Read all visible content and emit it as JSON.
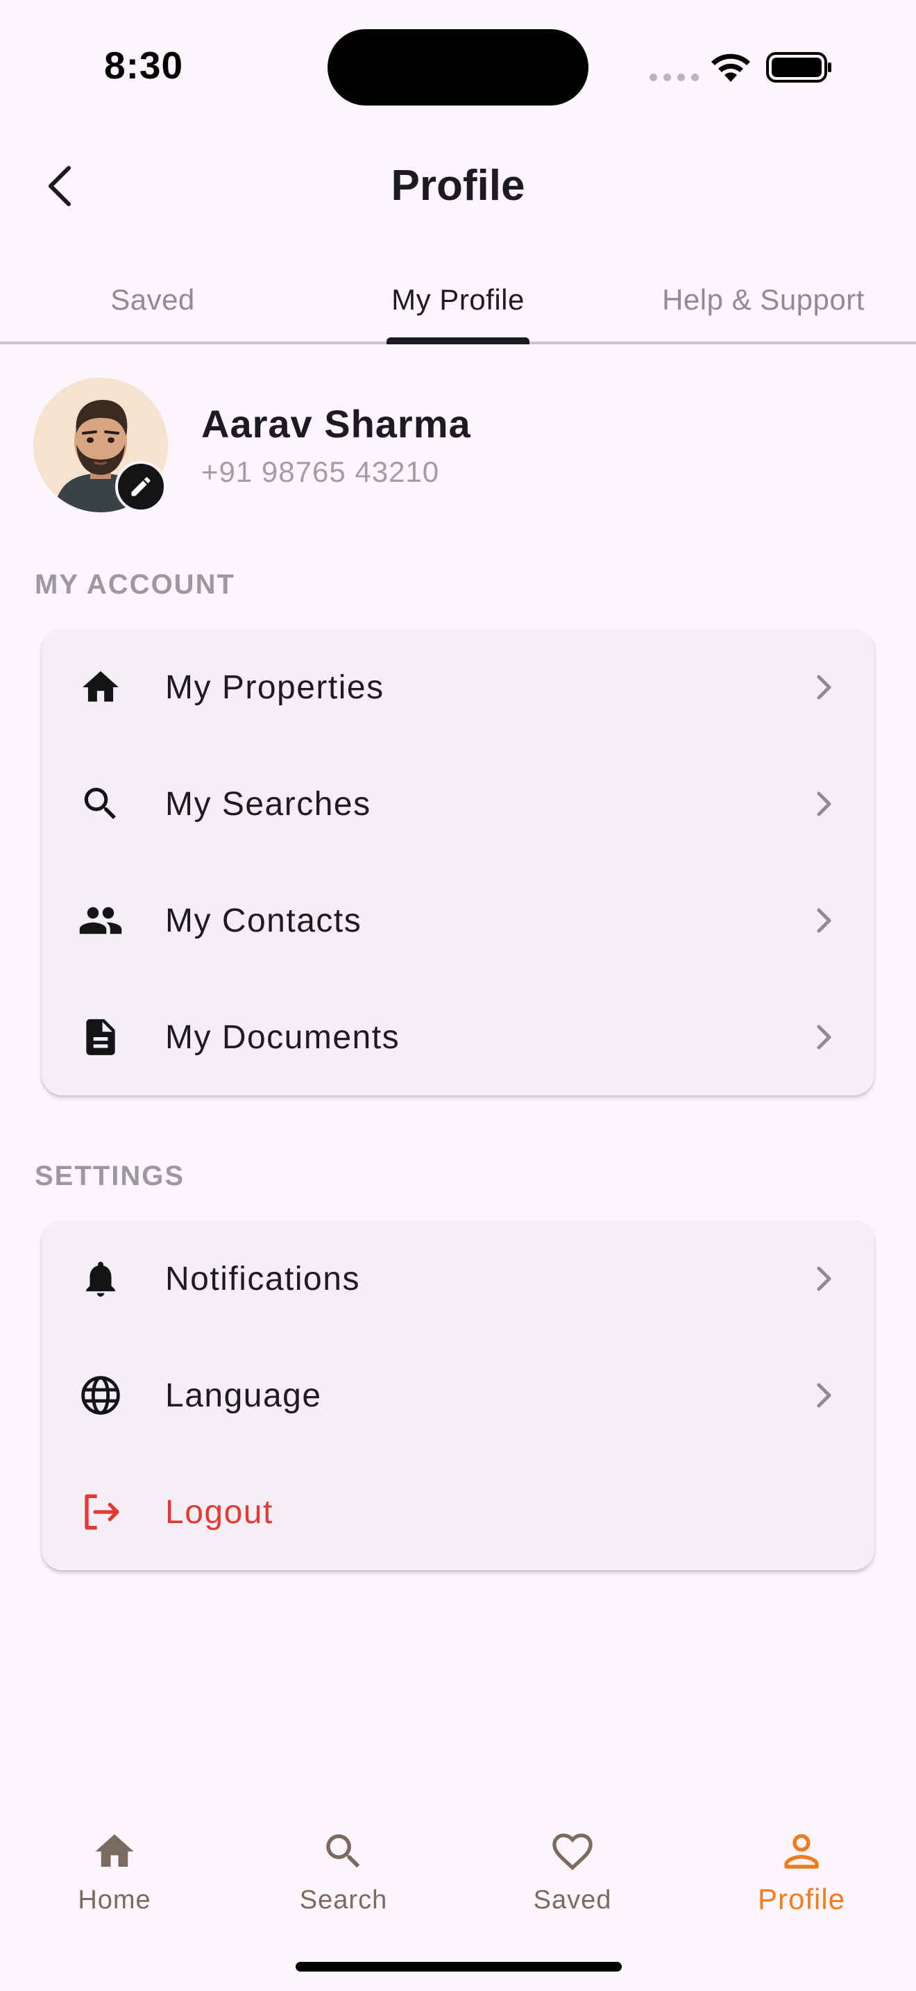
{
  "status_bar": {
    "time": "8:30"
  },
  "app_bar": {
    "title": "Profile",
    "back_icon": "chevron-left-icon"
  },
  "tabs": [
    {
      "label": "Saved",
      "active": false
    },
    {
      "label": "My Profile",
      "active": true
    },
    {
      "label": "Help & Support",
      "active": false
    }
  ],
  "profile": {
    "name": "Aarav Sharma",
    "phone": "+91 98765 43210",
    "edit_icon": "pencil-icon"
  },
  "account_section": {
    "title": "MY ACCOUNT",
    "items": [
      {
        "label": "My Properties",
        "icon": "home-icon"
      },
      {
        "label": "My Searches",
        "icon": "search-icon"
      },
      {
        "label": "My Contacts",
        "icon": "people-icon"
      },
      {
        "label": "My Documents",
        "icon": "document-icon"
      }
    ]
  },
  "settings_section": {
    "title": "SETTINGS",
    "items": [
      {
        "label": "Notifications",
        "icon": "bell-icon"
      },
      {
        "label": "Language",
        "icon": "globe-icon"
      },
      {
        "label": "Logout",
        "icon": "logout-icon",
        "danger": true
      }
    ]
  },
  "bottom_nav": [
    {
      "label": "Home",
      "icon": "home-icon",
      "active": false
    },
    {
      "label": "Search",
      "icon": "search-icon",
      "active": false
    },
    {
      "label": "Saved",
      "icon": "heart-icon",
      "active": false
    },
    {
      "label": "Profile",
      "icon": "person-icon",
      "active": true
    }
  ],
  "colors": {
    "background": "#fcf6fc",
    "card": "#f4eff5",
    "accent": "#ef7d1f",
    "danger": "#e53935",
    "nav_inactive": "#7a6a60"
  }
}
